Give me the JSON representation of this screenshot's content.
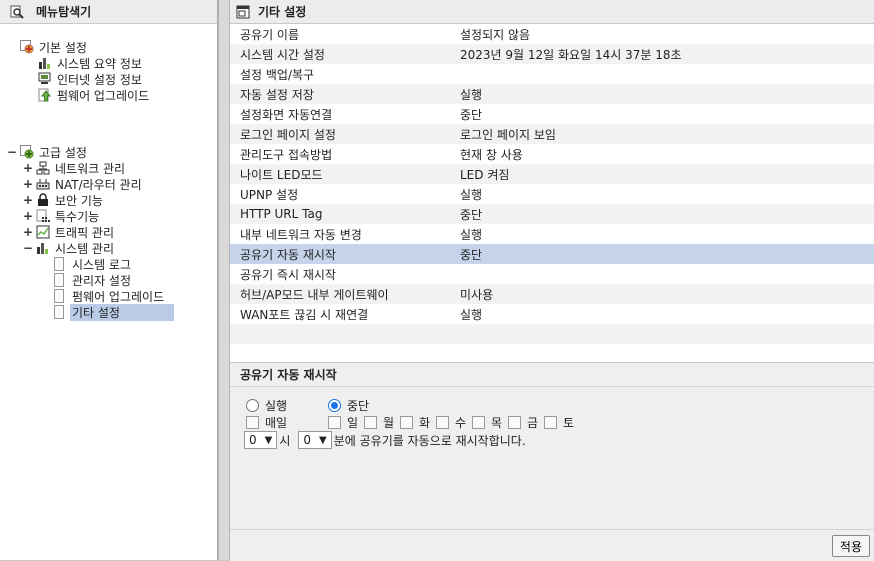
{
  "left": {
    "title": "메뉴탐색기",
    "basic": {
      "label": "기본 설정",
      "items": [
        "시스템 요약 정보",
        "인터넷 설정 정보",
        "펌웨어 업그레이드"
      ]
    },
    "advanced": {
      "toggle": "−",
      "label": "고급 설정",
      "groups": [
        {
          "toggle": "+",
          "label": "네트워크 관리"
        },
        {
          "toggle": "+",
          "label": "NAT/라우터 관리"
        },
        {
          "toggle": "+",
          "label": "보안 기능"
        },
        {
          "toggle": "+",
          "label": "특수기능"
        },
        {
          "toggle": "+",
          "label": "트래픽 관리"
        },
        {
          "toggle": "−",
          "label": "시스템 관리"
        }
      ],
      "system_items": [
        "시스템 로그",
        "관리자 설정",
        "펌웨어 업그레이드",
        "기타 설정"
      ]
    }
  },
  "right": {
    "title": "기타 설정",
    "rows": [
      {
        "key": "공유기 이름",
        "value": "설정되지 않음"
      },
      {
        "key": "시스템 시간 설정",
        "value": "2023년 9월 12일 화요일 14시 37분 18초"
      },
      {
        "key": "설정 백업/복구",
        "value": ""
      },
      {
        "key": "자동 설정 저장",
        "value": "실행"
      },
      {
        "key": "설정화면 자동연결",
        "value": "중단"
      },
      {
        "key": "로그인 페이지 설정",
        "value": "로그인 페이지 보임"
      },
      {
        "key": "관리도구 접속방법",
        "value": "현재 창 사용"
      },
      {
        "key": "나이트 LED모드",
        "value": "LED 켜짐"
      },
      {
        "key": "UPNP 설정",
        "value": "실행"
      },
      {
        "key": "HTTP URL Tag",
        "value": "중단"
      },
      {
        "key": "내부 네트워크 자동 변경",
        "value": "실행"
      },
      {
        "key": "공유기 자동 재시작",
        "value": "중단"
      },
      {
        "key": "공유기 즉시 재시작",
        "value": ""
      },
      {
        "key": "허브/AP모드 내부 게이트웨이",
        "value": "미사용"
      },
      {
        "key": "WAN포트 끊김 시 재연결",
        "value": "실행"
      }
    ]
  },
  "detail": {
    "title": "공유기 자동 재시작",
    "run_label": "실행",
    "stop_label": "중단",
    "daily_label": "매일",
    "days": [
      "일",
      "월",
      "화",
      "수",
      "목",
      "금",
      "토"
    ],
    "hour_value": "0",
    "hour_suffix": "시",
    "minute_value": "0",
    "minute_suffix": "분에 공유기를 자동으로 재시작합니다.",
    "apply_label": "적용"
  },
  "colors": {
    "selected_bg": "#b9cbe6",
    "highlight_row": "#c5d4ea",
    "radio_blue": "#1a73e8"
  }
}
